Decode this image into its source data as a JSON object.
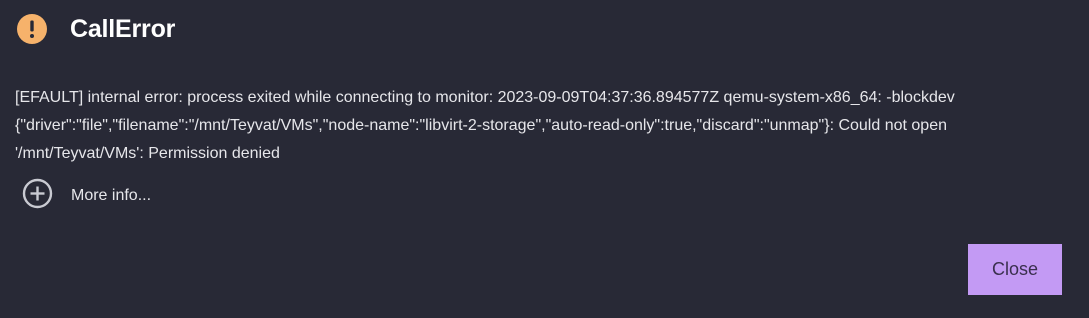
{
  "dialog": {
    "title": "CallError",
    "icon": "exclamation-circle-icon",
    "icon_color": "#f6b26b",
    "message_lines": [
      "[EFAULT] internal error: process exited while connecting to monitor: 2023-09-09T04:37:36.894577Z qemu-system-x86_64: -blockdev",
      "{\"driver\":\"file\",\"filename\":\"/mnt/Teyvat/VMs\",\"node-name\":\"libvirt-2-storage\",\"auto-read-only\":true,\"discard\":\"unmap\"}: Could not open",
      "'/mnt/Teyvat/VMs': Permission denied"
    ],
    "more_info_label": "More info...",
    "more_info_icon": "plus-circle-icon",
    "close_label": "Close",
    "accent_color": "#c39af4",
    "background_color": "#282936"
  }
}
